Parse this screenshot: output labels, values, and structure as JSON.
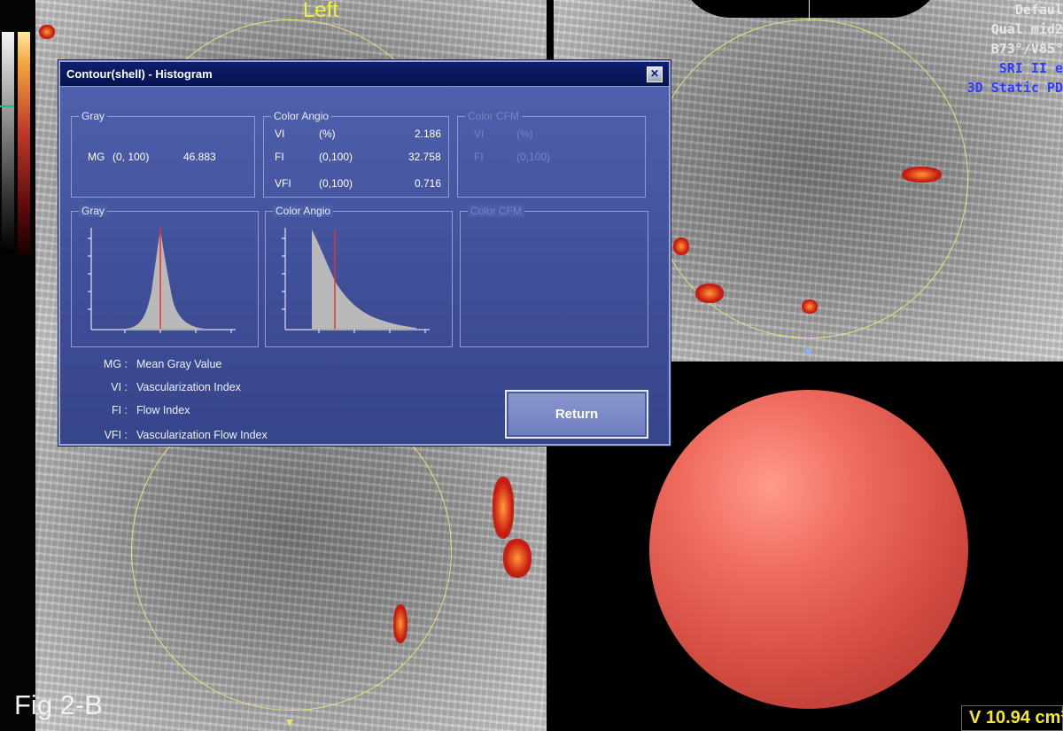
{
  "view_label": "Left",
  "overlay_info": [
    "Defaul",
    "Qual mid2",
    "B73°/V85°",
    "SRI II e",
    "3D Static PD"
  ],
  "dialog": {
    "title": "Contour(shell) - Histogram",
    "close_icon": "close-icon",
    "gray_group": {
      "legend": "Gray",
      "mg_label": "MG",
      "mg_range": "(0, 100)",
      "mg_value": "46.883"
    },
    "color_angio_group": {
      "legend": "Color Angio",
      "rows": [
        {
          "name": "VI",
          "range": "(%)",
          "value": "2.186"
        },
        {
          "name": "FI",
          "range": "(0,100)",
          "value": "32.758"
        },
        {
          "name": "VFI",
          "range": "(0,100)",
          "value": "0.716"
        }
      ]
    },
    "color_cfm_group": {
      "legend": "Color CFM",
      "rows": [
        {
          "name": "VI",
          "range": "(%)"
        },
        {
          "name": "FI",
          "range": "(0,100)"
        }
      ]
    },
    "hist_gray": {
      "legend": "Gray"
    },
    "hist_angio": {
      "legend": "Color Angio"
    },
    "hist_cfm": {
      "legend": "Color CFM"
    },
    "legend_notes": [
      {
        "abbr": "MG :",
        "text": "Mean Gray Value"
      },
      {
        "abbr": "VI :",
        "text": "Vascularization Index"
      },
      {
        "abbr": "FI :",
        "text": "Flow Index"
      },
      {
        "abbr": "VFI :",
        "text": "Vascularization Flow Index"
      }
    ],
    "return_label": "Return"
  },
  "figure_label": "Fig 2-B",
  "volume_readout": "V 10.94 cm³",
  "colors": {
    "roi_circle": "#e6e07a",
    "dialog_bg": "#4455a0",
    "histogram_fill": "#b8b8b8",
    "mean_line": "#e8332a"
  }
}
